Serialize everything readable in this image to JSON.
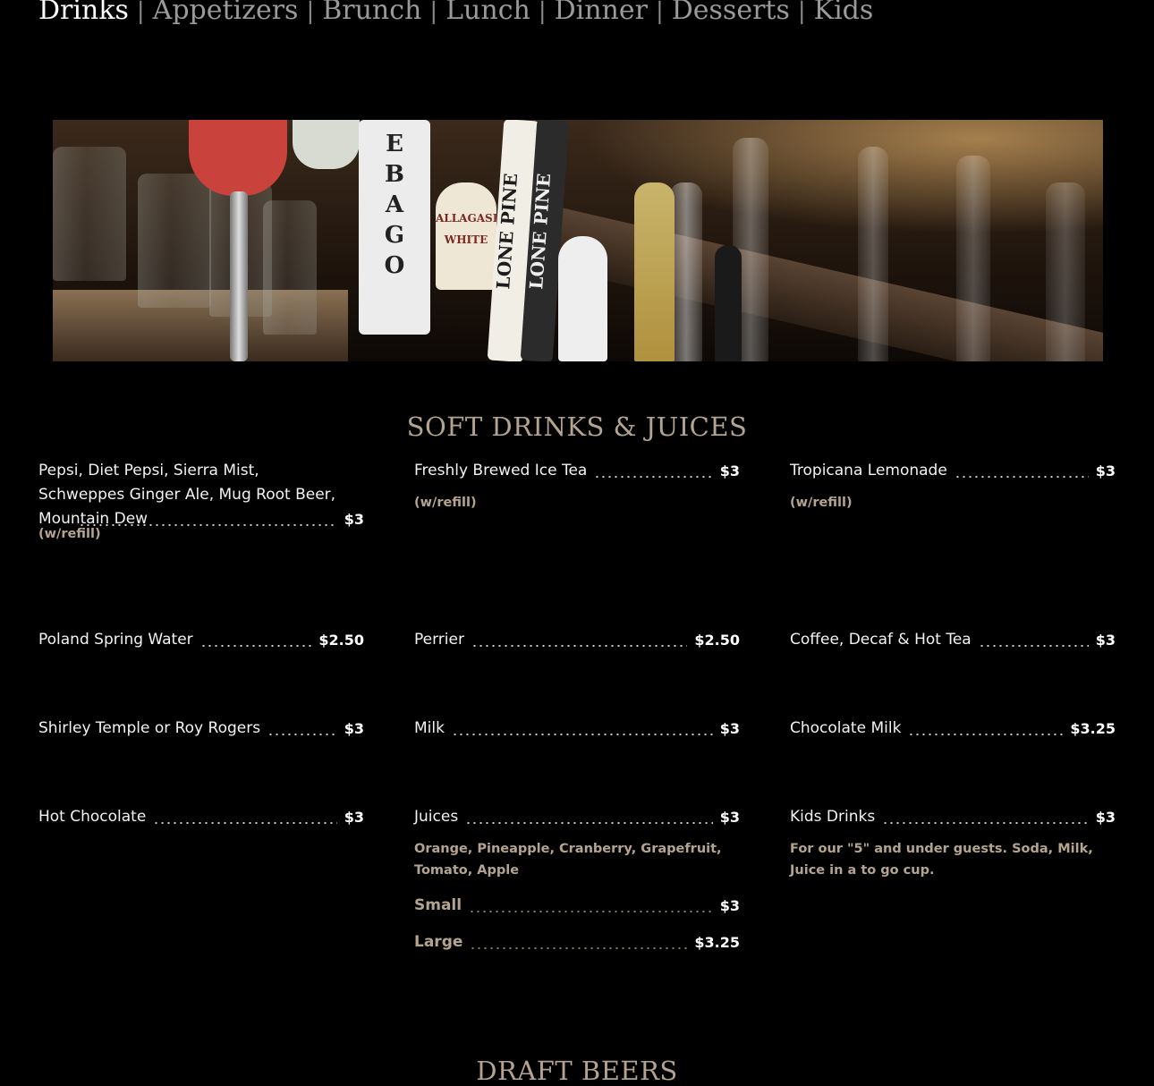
{
  "nav": {
    "tabs": [
      {
        "label": "Drinks",
        "active": true
      },
      {
        "label": "Appetizers"
      },
      {
        "label": "Brunch"
      },
      {
        "label": "Lunch"
      },
      {
        "label": "Dinner"
      },
      {
        "label": "Desserts"
      },
      {
        "label": "Kids"
      }
    ],
    "separator": "|"
  },
  "hero": {
    "tap_labels": [
      "EBAGO",
      "ALLAGASH WHITE",
      "LONE PINE",
      "LONE PINE"
    ]
  },
  "sections": {
    "soft_drinks": "SOFT DRINKS & JUICES",
    "draft_beers": "DRAFT BEERS"
  },
  "items": {
    "soda": {
      "name": "Pepsi, Diet Pepsi, Sierra Mist, Schweppes Ginger Ale, Mug Root Beer, Mountain Dew",
      "price": "$3",
      "note": "(w/refill)"
    },
    "ice_tea": {
      "name": "Freshly Brewed Ice Tea",
      "price": "$3",
      "note": "(w/refill)"
    },
    "lemonade": {
      "name": "Tropicana Lemonade",
      "price": "$3",
      "note": "(w/refill)"
    },
    "water": {
      "name": "Poland Spring Water",
      "price": "$2.50"
    },
    "perrier": {
      "name": "Perrier",
      "price": "$2.50"
    },
    "coffee": {
      "name": "Coffee, Decaf & Hot Tea",
      "price": "$3"
    },
    "shirley": {
      "name": "Shirley Temple or Roy Rogers",
      "price": "$3"
    },
    "milk": {
      "name": "Milk",
      "price": "$3"
    },
    "choc_milk": {
      "name": "Chocolate Milk",
      "price": "$3.25"
    },
    "hot_choc": {
      "name": "Hot Chocolate",
      "price": "$3"
    },
    "juices": {
      "name": "Juices",
      "price": "$3",
      "note": "Orange, Pineapple, Cranberry, Grapefruit, Tomato, Apple",
      "sizes": [
        {
          "name": "Small",
          "price": "$3"
        },
        {
          "name": "Large",
          "price": "$3.25"
        }
      ]
    },
    "kids": {
      "name": "Kids Drinks",
      "price": "$3",
      "note": "For our \"5\" and under guests. Soda, Milk, Juice in a to go cup."
    }
  },
  "colors": {
    "accent": "#b4a48f",
    "background": "#000000"
  }
}
